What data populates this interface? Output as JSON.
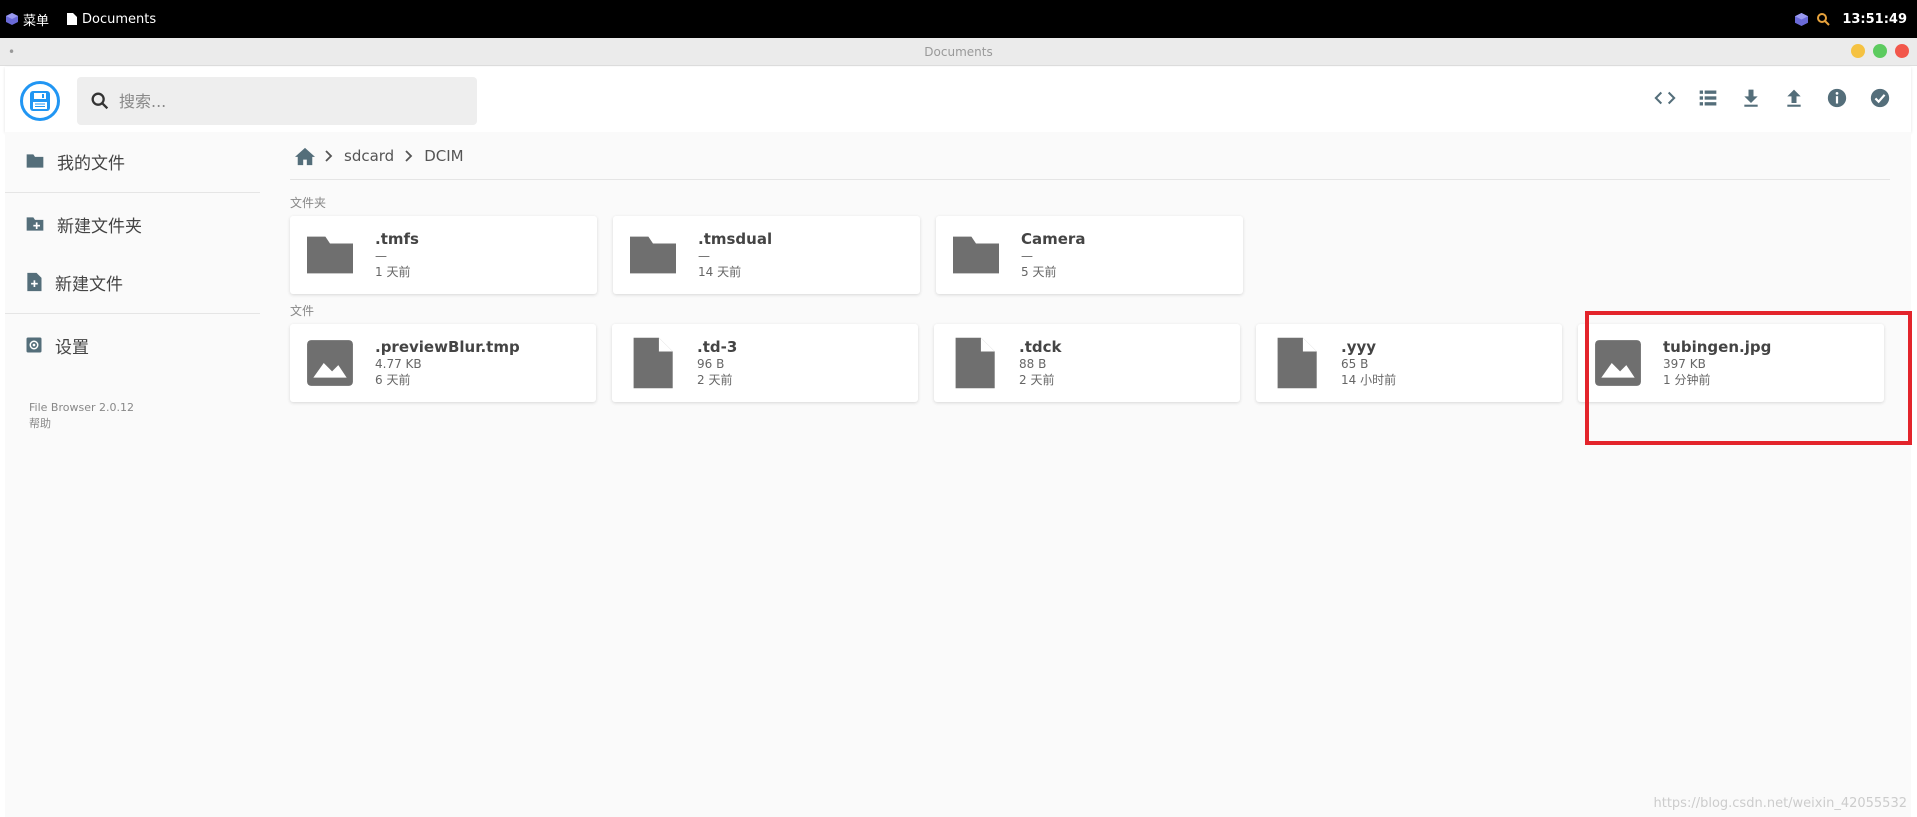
{
  "taskbar": {
    "menu_label": "菜单",
    "window_label": "Documents",
    "clock": "13:51:49"
  },
  "window": {
    "title": "Documents",
    "controls": [
      {
        "name": "minimize",
        "color": "#f5c242"
      },
      {
        "name": "maximize",
        "color": "#5ccb5f"
      },
      {
        "name": "close",
        "color": "#f2574b"
      }
    ]
  },
  "header": {
    "search_placeholder": "搜索...",
    "actions": [
      "code-icon",
      "list-view-icon",
      "download-icon",
      "upload-icon",
      "info-icon",
      "select-icon"
    ]
  },
  "sidebar": {
    "items": [
      {
        "label": "我的文件",
        "icon": "folder-icon"
      },
      {
        "label": "新建文件夹",
        "icon": "new-folder-icon"
      },
      {
        "label": "新建文件",
        "icon": "new-file-icon"
      },
      {
        "label": "设置",
        "icon": "settings-icon"
      }
    ],
    "version": "File Browser 2.0.12",
    "help": "帮助"
  },
  "breadcrumb": [
    "sdcard",
    "DCIM"
  ],
  "folders": {
    "title": "文件夹",
    "items": [
      {
        "name": ".tmfs",
        "size": "—",
        "modified": "1 天前"
      },
      {
        "name": ".tmsdual",
        "size": "—",
        "modified": "14 天前"
      },
      {
        "name": "Camera",
        "size": "—",
        "modified": "5 天前"
      }
    ]
  },
  "files": {
    "title": "文件",
    "items": [
      {
        "name": ".previewBlur.tmp",
        "size": "4.77 KB",
        "modified": "6 天前",
        "icon": "image-icon"
      },
      {
        "name": ".td-3",
        "size": "96 B",
        "modified": "2 天前",
        "icon": "file-icon"
      },
      {
        "name": ".tdck",
        "size": "88 B",
        "modified": "2 天前",
        "icon": "file-icon"
      },
      {
        "name": ".yyy",
        "size": "65 B",
        "modified": "14 小时前",
        "icon": "file-icon"
      },
      {
        "name": "tubingen.jpg",
        "size": "397 KB",
        "modified": "1 分钟前",
        "icon": "image-icon"
      }
    ]
  },
  "colors": {
    "accent": "#2196f3",
    "icon_gray": "#6f6f6f",
    "highlight": "#e3242b"
  },
  "watermark": "https://blog.csdn.net/weixin_42055532"
}
